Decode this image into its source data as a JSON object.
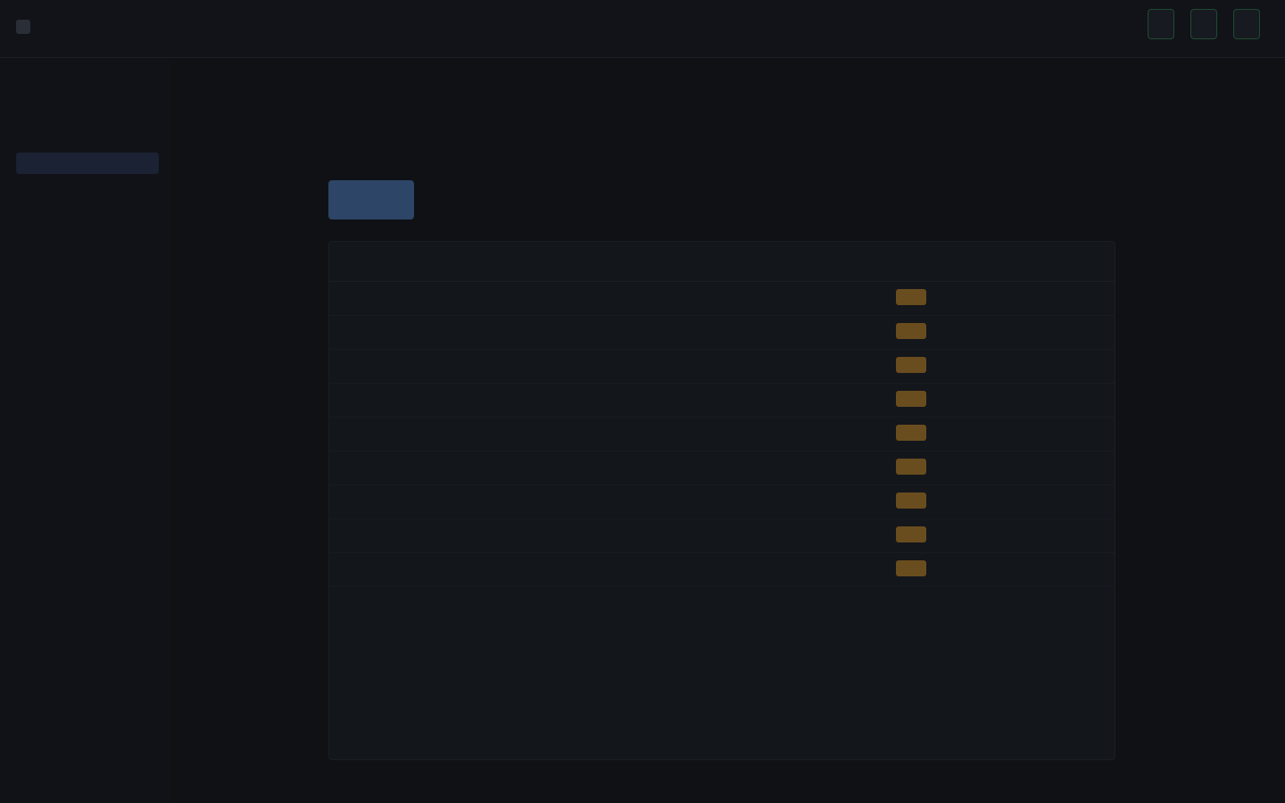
{
  "window": {
    "title": ""
  },
  "header": {
    "brand_title": "",
    "brand_subtitle": "",
    "center_label": "",
    "actions": [
      {
        "label": ""
      },
      {
        "label": ""
      },
      {
        "label": ""
      }
    ]
  },
  "sidebar": {
    "items": [
      {
        "label": ""
      },
      {
        "label": ""
      },
      {
        "label": ""
      },
      {
        "label": "",
        "active": true
      },
      {
        "label": ""
      },
      {
        "label": ""
      },
      {
        "label": ""
      }
    ],
    "section_items": [
      {
        "label": ""
      },
      {
        "label": ""
      },
      {
        "label": ""
      },
      {
        "label": ""
      },
      {
        "label": ""
      }
    ],
    "bottom_items": [
      {
        "label": ""
      },
      {
        "label": ""
      }
    ]
  },
  "main": {
    "title": "",
    "subtitle": "",
    "toolbar": {
      "primary_label": "",
      "secondary_labels": [
        "",
        ""
      ]
    },
    "table": {
      "headers": [
        "",
        "",
        "",
        "",
        "",
        "",
        ""
      ],
      "rows": [
        {
          "c0": "",
          "c1": "",
          "c2": "",
          "c3": "",
          "badge": "",
          "c5": "",
          "actions": ""
        },
        {
          "c0": "",
          "c1": "",
          "c2": "",
          "c3": "",
          "badge": "",
          "c5": "",
          "actions": ""
        },
        {
          "c0": "",
          "c1": "",
          "c2": "",
          "c3": "",
          "badge": "",
          "c5": "",
          "actions": ""
        },
        {
          "c0": "",
          "c1": "",
          "c2": "",
          "c3": "",
          "badge": "",
          "c5": "",
          "actions": ""
        },
        {
          "c0": "",
          "c1": "",
          "c2": "",
          "c3": "",
          "badge": "",
          "c5": "",
          "actions": ""
        },
        {
          "c0": "",
          "c1": "",
          "c2": "",
          "c3": "",
          "badge": "",
          "c5": "",
          "actions": ""
        },
        {
          "c0": "",
          "c1": "",
          "c2": "",
          "c3": "",
          "badge": "",
          "c5": "",
          "actions": ""
        },
        {
          "c0": "",
          "c1": "",
          "c2": "",
          "c3": "",
          "badge": "",
          "c5": "",
          "actions": ""
        },
        {
          "c0": "",
          "c1": "",
          "c2": "",
          "c3": "",
          "badge": "",
          "c5": "",
          "actions": ""
        }
      ]
    }
  },
  "footer": {
    "note": ""
  },
  "colors": {
    "background": "#0f1115",
    "accent": "#2d4566",
    "badge": "#6a4d1e",
    "badge_text": "#e3b56d",
    "success": "#1f4a32"
  }
}
